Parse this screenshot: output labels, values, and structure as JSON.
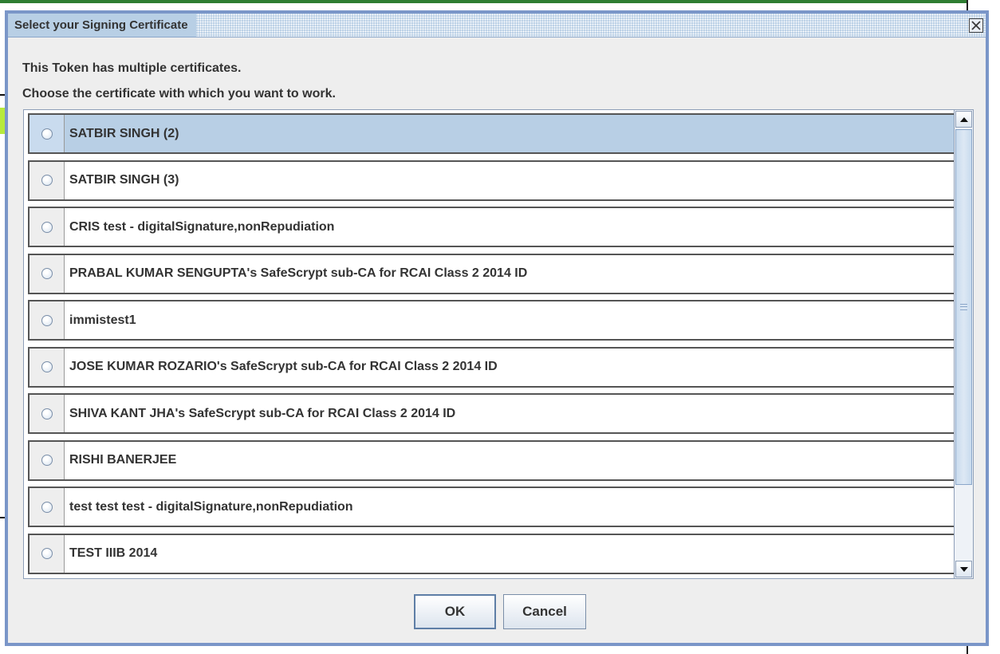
{
  "dialog": {
    "title": "Select your Signing Certificate",
    "message_line1": "This Token has multiple certificates.",
    "message_line2": "Choose the certificate with which you want to work."
  },
  "certificates": [
    {
      "label": "SATBIR SINGH (2)",
      "selected": true
    },
    {
      "label": "SATBIR SINGH (3)",
      "selected": false
    },
    {
      "label": "CRIS test - digitalSignature,nonRepudiation",
      "selected": false
    },
    {
      "label": "PRABAL KUMAR SENGUPTA's SafeScrypt sub-CA for RCAI Class 2 2014 ID",
      "selected": false
    },
    {
      "label": "immistest1",
      "selected": false
    },
    {
      "label": "JOSE KUMAR ROZARIO's SafeScrypt sub-CA for RCAI Class 2 2014 ID",
      "selected": false
    },
    {
      "label": "SHIVA KANT JHA's SafeScrypt sub-CA for RCAI Class 2 2014 ID",
      "selected": false
    },
    {
      "label": "RISHI BANERJEE",
      "selected": false
    },
    {
      "label": "test test test - digitalSignature,nonRepudiation",
      "selected": false
    },
    {
      "label": "TEST IIIB 2014",
      "selected": false
    }
  ],
  "buttons": {
    "ok_label": "OK",
    "cancel_label": "Cancel"
  },
  "icons": {
    "close": "close-icon",
    "scroll_up": "arrow-up-icon",
    "scroll_down": "arrow-down-icon",
    "radio": "radio-button-icon"
  },
  "colors": {
    "title_bar": "#b8cfe5",
    "dialog_border": "#7a96c8",
    "selected_row": "#b8cfe5",
    "dialog_background": "#eeeeee"
  }
}
